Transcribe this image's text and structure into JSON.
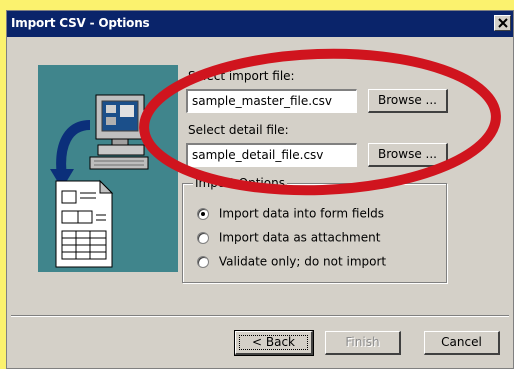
{
  "window": {
    "title": "Import CSV - Options",
    "close_symbol": "×"
  },
  "import_file": {
    "label": "Select import file:",
    "value": "sample_master_file.csv",
    "browse_label": "Browse ..."
  },
  "detail_file": {
    "label": "Select detail file:",
    "value": "sample_detail_file.csv",
    "browse_label": "Browse ..."
  },
  "import_options": {
    "legend": "Import Options",
    "options": [
      {
        "label": "Import data into form fields",
        "checked": true
      },
      {
        "label": "Import data as attachment",
        "checked": false
      },
      {
        "label": "Validate only; do not import",
        "checked": false
      }
    ]
  },
  "footer": {
    "back_label": "< Back",
    "finish_label": "Finish",
    "cancel_label": "Cancel"
  },
  "annotation": {
    "highlight_color": "#d0141e"
  },
  "illustration": {
    "icons": [
      "computer-icon",
      "arrow-icon",
      "document-icon"
    ]
  }
}
